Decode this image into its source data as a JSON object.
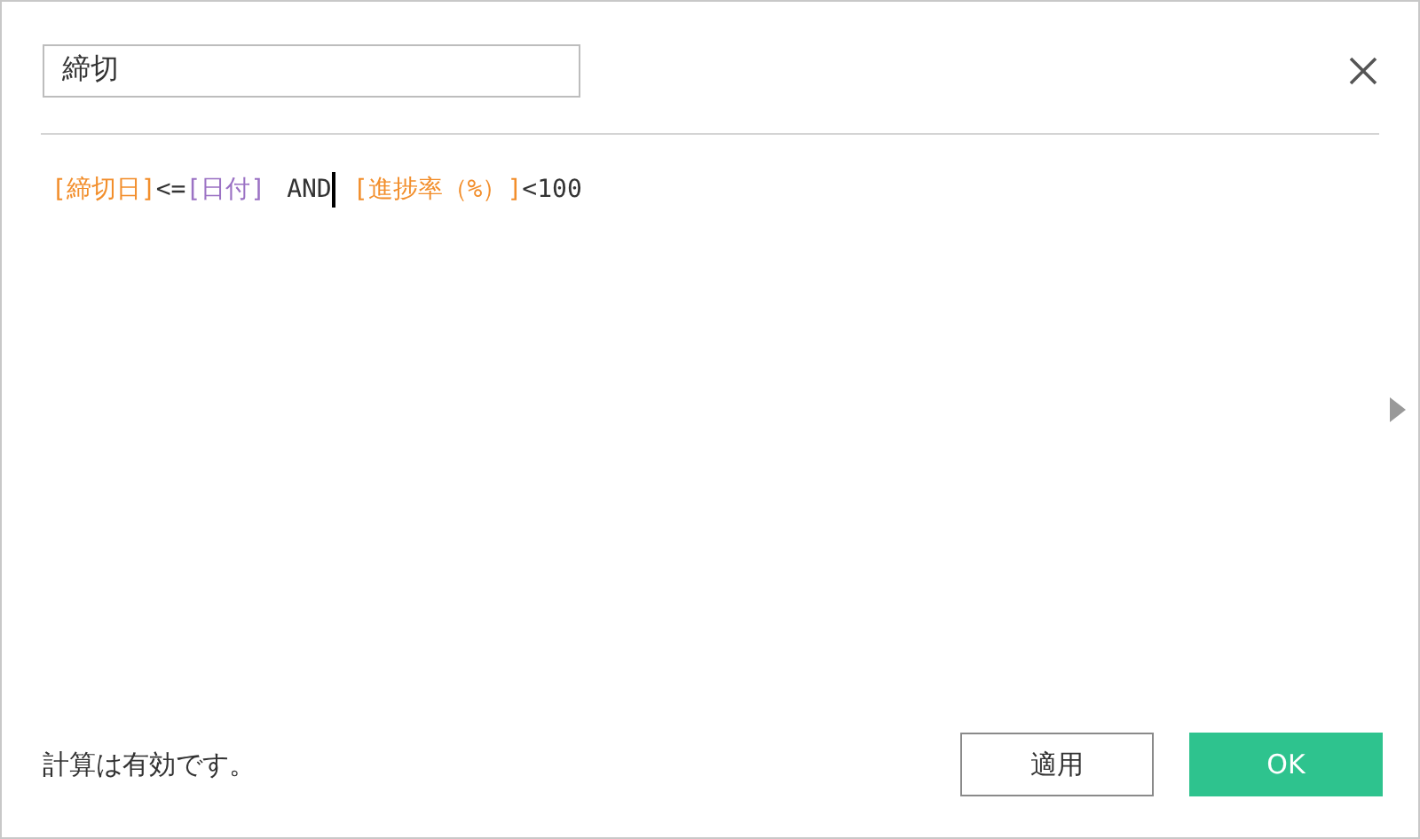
{
  "name_field": {
    "value": "締切"
  },
  "formula": [
    {
      "kind": "field",
      "text": "[締切日]",
      "cursor_after": false
    },
    {
      "kind": "operator",
      "text": "<=",
      "cursor_after": false
    },
    {
      "kind": "parameter",
      "text": "[日付]",
      "cursor_after": false
    },
    {
      "kind": "keyword",
      "text": "AND",
      "cursor_after": true
    },
    {
      "kind": "field",
      "text": "[進捗率（%）]",
      "cursor_after": false
    },
    {
      "kind": "operator",
      "text": "<100",
      "cursor_after": false
    }
  ],
  "status": "計算は有効です。",
  "buttons": [
    {
      "kind": "secondary",
      "label": "適用"
    },
    {
      "kind": "primary",
      "label": "OK"
    }
  ]
}
